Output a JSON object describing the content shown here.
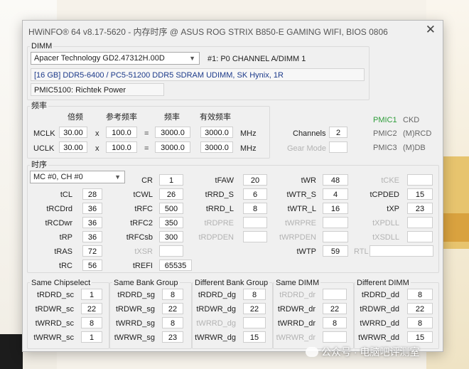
{
  "window": {
    "title": "HWiNFO® 64 v8.17-5620 - 内存时序 @ ASUS ROG STRIX B850-E GAMING WIFI, BIOS 0806"
  },
  "dimm": {
    "section": "DIMM",
    "selected_module": "Apacer Technology GD2.47312H.00D",
    "slot": "#1: P0 CHANNEL A/DIMM 1",
    "description": "[16 GB] DDR5-6400 / PC5-51200 DDR5 SDRAM UDIMM, SK Hynix, 1R",
    "pmic": "PMIC5100: Richtek Power"
  },
  "freq": {
    "section": "频率",
    "headers": {
      "multiplier": "倍频",
      "ref": "参考频率",
      "freq": "频率",
      "effective": "有效频率"
    },
    "mclk": {
      "label": "MCLK",
      "mult": "30.00",
      "x": "x",
      "ref": "100.0",
      "eq": "=",
      "freq": "3000.0",
      "eff": "3000.0",
      "unit": "MHz"
    },
    "uclk": {
      "label": "UCLK",
      "mult": "30.00",
      "x": "x",
      "ref": "100.0",
      "eq": "=",
      "freq": "3000.0",
      "eff": "3000.0",
      "unit": "MHz"
    },
    "channels_label": "Channels",
    "channels": "2",
    "gear_label": "Gear Mode",
    "pmic1": "PMIC1",
    "pmic1_val": "CKD",
    "pmic2": "PMIC2",
    "pmic2_val": "(M)RCD",
    "pmic3": "PMIC3",
    "pmic3_val": "(M)DB"
  },
  "timing": {
    "section": "时序",
    "channel_select": "MC #0, CH #0",
    "cr": {
      "label": "CR",
      "value": "1"
    },
    "tfaw": {
      "label": "tFAW",
      "value": "20"
    },
    "twr": {
      "label": "tWR",
      "value": "48"
    },
    "tcke": {
      "label": "tCKE",
      "value": ""
    },
    "tcl": {
      "label": "tCL",
      "value": "28"
    },
    "tcwl": {
      "label": "tCWL",
      "value": "26"
    },
    "trrd_s": {
      "label": "tRRD_S",
      "value": "6"
    },
    "twtr_s": {
      "label": "tWTR_S",
      "value": "4"
    },
    "tcpded": {
      "label": "tCPDED",
      "value": "15"
    },
    "trcdrd": {
      "label": "tRCDrd",
      "value": "36"
    },
    "trfc": {
      "label": "tRFC",
      "value": "500"
    },
    "trrd_l": {
      "label": "tRRD_L",
      "value": "8"
    },
    "twtr_l": {
      "label": "tWTR_L",
      "value": "16"
    },
    "txp": {
      "label": "tXP",
      "value": "23"
    },
    "trcdwr": {
      "label": "tRCDwr",
      "value": "36"
    },
    "trfc2": {
      "label": "tRFC2",
      "value": "350"
    },
    "trdpre": {
      "label": "tRDPRE",
      "value": ""
    },
    "twrpre": {
      "label": "tWRPRE",
      "value": ""
    },
    "txpdll": {
      "label": "tXPDLL",
      "value": ""
    },
    "trp": {
      "label": "tRP",
      "value": "36"
    },
    "trfcsb": {
      "label": "tRFCsb",
      "value": "300"
    },
    "trdpden": {
      "label": "tRDPDEN",
      "value": ""
    },
    "twrpden": {
      "label": "tWRPDEN",
      "value": ""
    },
    "txsdll": {
      "label": "tXSDLL",
      "value": ""
    },
    "tras": {
      "label": "tRAS",
      "value": "72"
    },
    "txsr": {
      "label": "tXSR",
      "value": ""
    },
    "twtp": {
      "label": "tWTP",
      "value": "59"
    },
    "rtl": {
      "label": "RTL",
      "value": ""
    },
    "trc": {
      "label": "tRC",
      "value": "56"
    },
    "trefi": {
      "label": "tREFI",
      "value": "65535"
    }
  },
  "groups": {
    "same_chipselect": {
      "title": "Same Chipselect",
      "rows": [
        {
          "label": "tRDRD_sc",
          "value": "1"
        },
        {
          "label": "tRDWR_sc",
          "value": "22"
        },
        {
          "label": "tWRRD_sc",
          "value": "8"
        },
        {
          "label": "tWRWR_sc",
          "value": "1"
        }
      ]
    },
    "same_bank_group": {
      "title": "Same Bank Group",
      "rows": [
        {
          "label": "tRDRD_sg",
          "value": "8"
        },
        {
          "label": "tRDWR_sg",
          "value": "22"
        },
        {
          "label": "tWRRD_sg",
          "value": "8"
        },
        {
          "label": "tWRWR_sg",
          "value": "23"
        }
      ]
    },
    "different_bank_group": {
      "title": "Different Bank Group",
      "rows": [
        {
          "label": "tRDRD_dg",
          "value": "8"
        },
        {
          "label": "tRDWR_dg",
          "value": "22"
        },
        {
          "label": "tWRRD_dg",
          "value": ""
        },
        {
          "label": "tWRWR_dg",
          "value": "15"
        }
      ]
    },
    "same_dimm": {
      "title": "Same DIMM",
      "rows": [
        {
          "label": "tRDRD_dr",
          "value": ""
        },
        {
          "label": "tRDWR_dr",
          "value": "22"
        },
        {
          "label": "tWRRD_dr",
          "value": "8"
        },
        {
          "label": "tWRWR_dr",
          "value": ""
        }
      ]
    },
    "different_dimm": {
      "title": "Different DIMM",
      "rows": [
        {
          "label": "tRDRD_dd",
          "value": "8"
        },
        {
          "label": "tRDWR_dd",
          "value": "22"
        },
        {
          "label": "tWRRD_dd",
          "value": "8"
        },
        {
          "label": "tWRWR_dd",
          "value": "15"
        }
      ]
    }
  },
  "watermark": {
    "text": "公众号 · 电脑吧评测室"
  },
  "colors": {
    "pmic_active": "#2e9d3a",
    "dim_text": "#b3b3b3",
    "info_text": "#1c3a8a"
  }
}
